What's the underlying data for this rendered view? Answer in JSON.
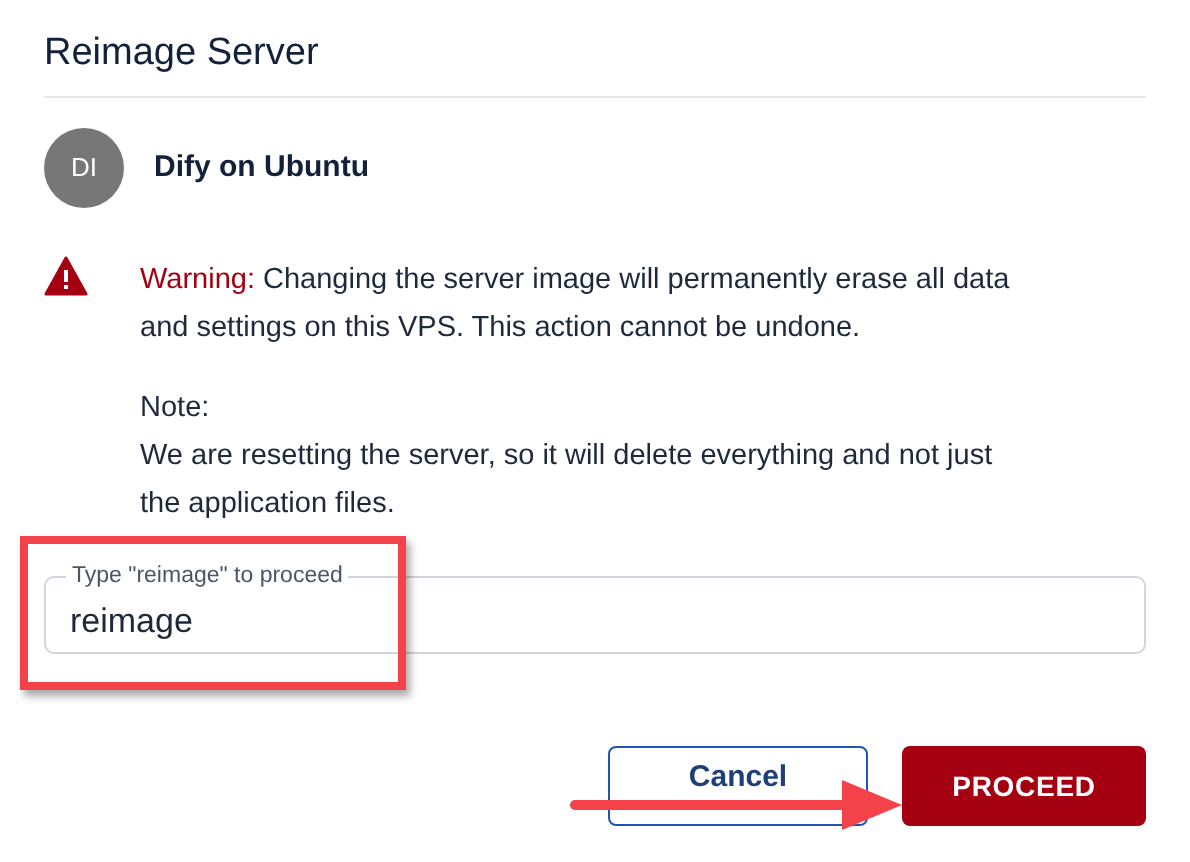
{
  "dialog": {
    "title": "Reimage Server"
  },
  "server": {
    "initials": "DI",
    "name": "Dify on Ubuntu"
  },
  "warning": {
    "label": "Warning:",
    "text": "Changing the server image will permanently erase all data and settings on this VPS. This action cannot be undone."
  },
  "note": {
    "label": "Note:",
    "text": "We are resetting the server, so it will delete everything and not just the application files."
  },
  "confirm_field": {
    "label": "Type \"reimage\" to proceed",
    "value": "reimage"
  },
  "buttons": [
    {
      "kind": "secondary",
      "label": "Cancel"
    },
    {
      "kind": "primary",
      "label": "PROCEED"
    }
  ]
}
